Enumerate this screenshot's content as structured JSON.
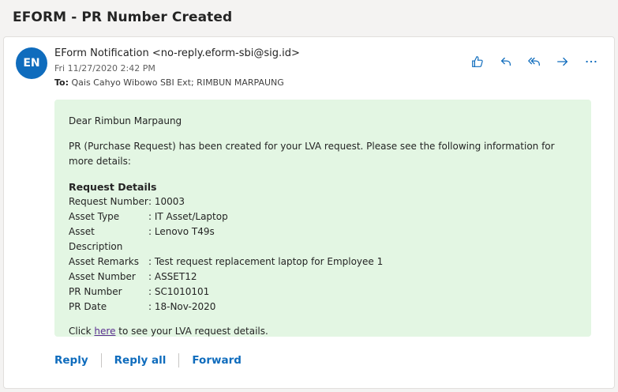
{
  "subject": "EFORM - PR Number Created",
  "message": {
    "avatar_initials": "EN",
    "from": "EForm Notification <no-reply.eform-sbi@sig.id>",
    "date": "Fri 11/27/2020 2:42 PM",
    "to_label": "To:",
    "to_value": "Qais Cahyo Wibowo SBI Ext; RIMBUN MARPAUNG"
  },
  "actions": {
    "like": "thumbs-up-icon",
    "reply": "reply-icon",
    "reply_all": "reply-all-icon",
    "forward": "forward-icon",
    "more": "more-icon"
  },
  "body": {
    "greeting": "Dear Rimbun Marpaung",
    "paragraph": "PR (Purchase Request) has been created for your LVA request. Please see the following information for more details:",
    "details_title": "Request Details",
    "details": [
      {
        "key": "Request Number",
        "value": ": 10003"
      },
      {
        "key": "Asset Type",
        "value": ": IT Asset/Laptop"
      },
      {
        "key": "Asset Description",
        "value": ": Lenovo T49s"
      },
      {
        "key": "Asset Remarks",
        "value": ": Test request replacement laptop for Employee 1"
      },
      {
        "key": "Asset Number",
        "value": ": ASSET12"
      },
      {
        "key": "PR Number",
        "value": ": SC1010101"
      },
      {
        "key": "PR Date",
        "value": ": 18-Nov-2020"
      }
    ],
    "click_prefix": "Click ",
    "click_link": "here",
    "click_suffix": " to see your LVA request details."
  },
  "footer": {
    "reply": "Reply",
    "reply_all": "Reply all",
    "forward": "Forward"
  },
  "colors": {
    "accent": "#0f6cbd",
    "body_bg": "#e3f6e3",
    "link": "#5c2e91"
  }
}
